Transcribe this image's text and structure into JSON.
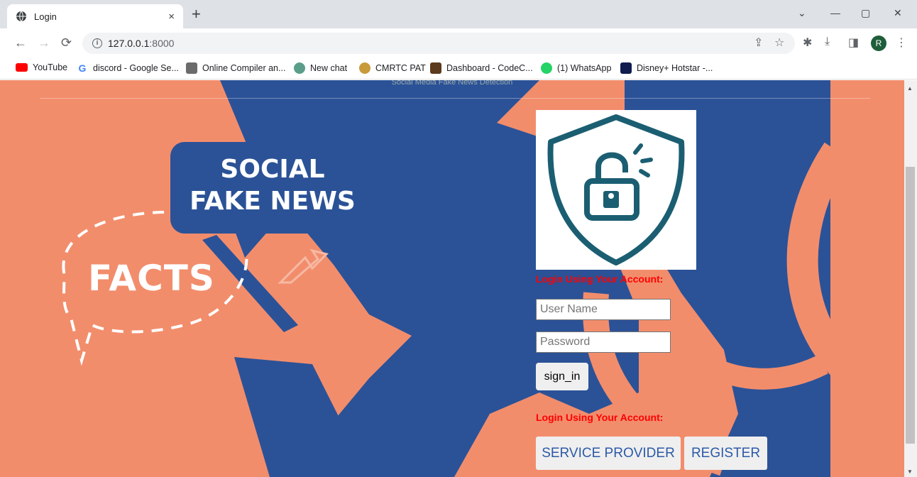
{
  "browser": {
    "tab_title": "Login",
    "tab_close": "×",
    "new_tab": "+",
    "url_host": "127.0.0.1",
    "url_port": ":8000",
    "profile_initial": "R",
    "window_controls": [
      "⌄",
      "—",
      "▢",
      "✕"
    ]
  },
  "bookmarks": [
    {
      "label": "YouTube",
      "icon": "youtube-icon",
      "color": "#ff0000"
    },
    {
      "label": "discord - Google Se...",
      "icon": "google-icon",
      "color": "#4285f4"
    },
    {
      "label": "Online Compiler an...",
      "icon": "compiler-icon",
      "color": "#6b6b6b"
    },
    {
      "label": "New chat",
      "icon": "chatgpt-icon",
      "color": "#5a9e8a"
    },
    {
      "label": "CMRTC PAT",
      "icon": "cmrtc-icon",
      "color": "#c89a3a"
    },
    {
      "label": "Dashboard - CodeC...",
      "icon": "codechef-icon",
      "color": "#5b3a1e"
    },
    {
      "label": "(1) WhatsApp",
      "icon": "whatsapp-icon",
      "color": "#25d366"
    },
    {
      "label": "Disney+ Hotstar -...",
      "icon": "hotstar-icon",
      "color": "#0f1c4d"
    }
  ],
  "page": {
    "header_text": "Social Media Fake News Detection",
    "bubble_line1": "SOCIAL",
    "bubble_line2": "FAKE NEWS",
    "facts_text": "FACTS",
    "login_heading": "Login Using Your Account:",
    "username_placeholder": "User Name",
    "password_placeholder": "Password",
    "signin_label": "sign_in",
    "login_heading_2": "Login Using Your Account:",
    "service_provider_label": "SERVICE PROVIDER",
    "register_label": "REGISTER"
  },
  "colors": {
    "background_salmon": "#f28d6c",
    "dark_blue": "#2b5297",
    "map_blue": "#4f7fd0",
    "lock_teal": "#1b5e72",
    "heading_red": "#ff0000"
  }
}
